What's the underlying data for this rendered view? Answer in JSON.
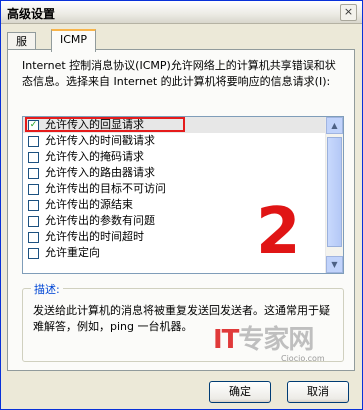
{
  "window": {
    "title": "高级设置",
    "close_label": "×"
  },
  "tabs": [
    {
      "label": "服务",
      "active": false
    },
    {
      "label": "ICMP",
      "active": true
    }
  ],
  "intro_text": "Internet 控制消息协议(ICMP)允许网络上的计算机共享错误和状态信息。选择来自 Internet 的此计算机将要响应的信息请求(I):",
  "list": {
    "items": [
      {
        "label": "允许传入的回显请求",
        "checked": true
      },
      {
        "label": "允许传入的时间戳请求",
        "checked": false
      },
      {
        "label": "允许传入的掩码请求",
        "checked": false
      },
      {
        "label": "允许传入的路由器请求",
        "checked": false
      },
      {
        "label": "允许传出的目标不可访问",
        "checked": false
      },
      {
        "label": "允许传出的源结束",
        "checked": false
      },
      {
        "label": "允许传出的参数有问题",
        "checked": false
      },
      {
        "label": "允许传出的时间超时",
        "checked": false
      },
      {
        "label": "允许重定向",
        "checked": false
      }
    ]
  },
  "annotation_number": "2",
  "description": {
    "label": "描述:",
    "text": "发送给此计算机的消息将被重复发送回发送者。这通常用于疑难解答，例如，ping 一台机器。"
  },
  "buttons": {
    "ok": "确定",
    "cancel": "取消"
  },
  "watermark": {
    "brand_it": "IT",
    "brand_rest": "专家网",
    "sub": "Ciocio.com"
  }
}
